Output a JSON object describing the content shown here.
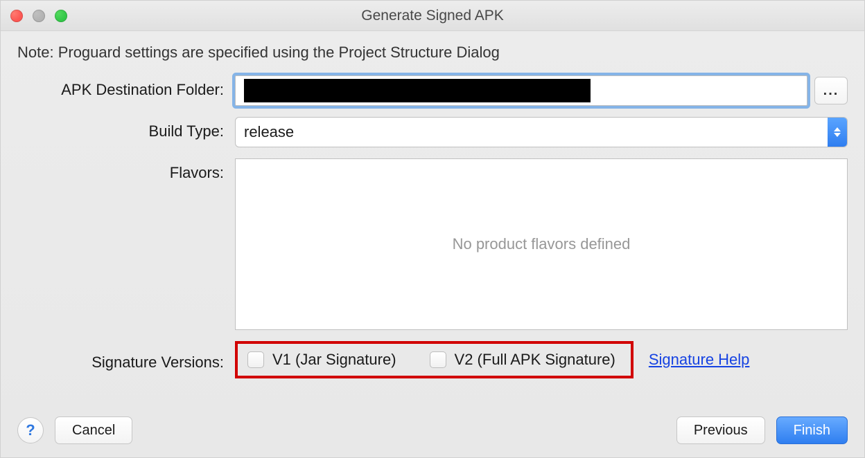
{
  "window": {
    "title": "Generate Signed APK"
  },
  "note": "Note: Proguard settings are specified using the Project Structure Dialog",
  "labels": {
    "apk_folder": "APK Destination Folder:",
    "build_type": "Build Type:",
    "flavors": "Flavors:",
    "sig_versions": "Signature Versions:"
  },
  "fields": {
    "apk_folder_value": "",
    "browse_label": "...",
    "build_type_value": "release",
    "flavors_placeholder": "No product flavors defined"
  },
  "signature": {
    "v1_label": "V1 (Jar Signature)",
    "v2_label": "V2 (Full APK Signature)",
    "v1_checked": false,
    "v2_checked": false,
    "help_link": "Signature Help"
  },
  "footer": {
    "help": "?",
    "cancel": "Cancel",
    "previous": "Previous",
    "finish": "Finish"
  }
}
